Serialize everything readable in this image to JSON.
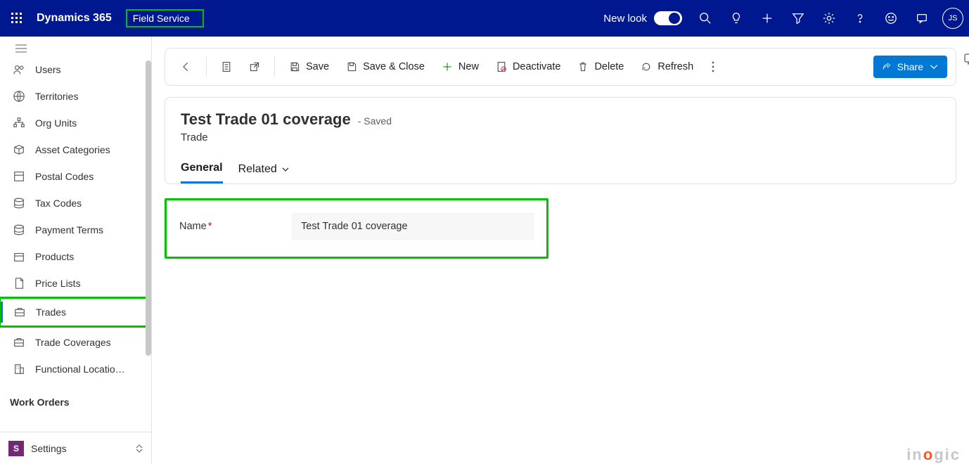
{
  "header": {
    "brand": "Dynamics 365",
    "app_name": "Field Service",
    "new_look_label": "New look",
    "avatar_initials": "JS"
  },
  "sidebar": {
    "items": [
      {
        "label": "Users",
        "icon": "users-icon"
      },
      {
        "label": "Territories",
        "icon": "globe-icon"
      },
      {
        "label": "Org Units",
        "icon": "org-icon"
      },
      {
        "label": "Asset Categories",
        "icon": "asset-icon"
      },
      {
        "label": "Postal Codes",
        "icon": "postal-icon"
      },
      {
        "label": "Tax Codes",
        "icon": "stack-icon"
      },
      {
        "label": "Payment Terms",
        "icon": "stack-icon"
      },
      {
        "label": "Products",
        "icon": "box-icon"
      },
      {
        "label": "Price Lists",
        "icon": "doc-icon"
      },
      {
        "label": "Trades",
        "icon": "briefcase-icon",
        "active": true
      },
      {
        "label": "Trade Coverages",
        "icon": "briefcase-icon"
      },
      {
        "label": "Functional Locatio…",
        "icon": "building-icon"
      }
    ],
    "group_label": "Work Orders",
    "area_switcher": {
      "badge": "S",
      "label": "Settings"
    }
  },
  "commandbar": {
    "save": "Save",
    "save_close": "Save & Close",
    "new": "New",
    "deactivate": "Deactivate",
    "delete": "Delete",
    "refresh": "Refresh",
    "share": "Share"
  },
  "record": {
    "title": "Test Trade 01 coverage",
    "saved_label": "- Saved",
    "entity": "Trade",
    "tabs": {
      "general": "General",
      "related": "Related"
    },
    "field_name_label": "Name",
    "field_name_value": "Test Trade 01 coverage"
  },
  "watermark": "inogic"
}
